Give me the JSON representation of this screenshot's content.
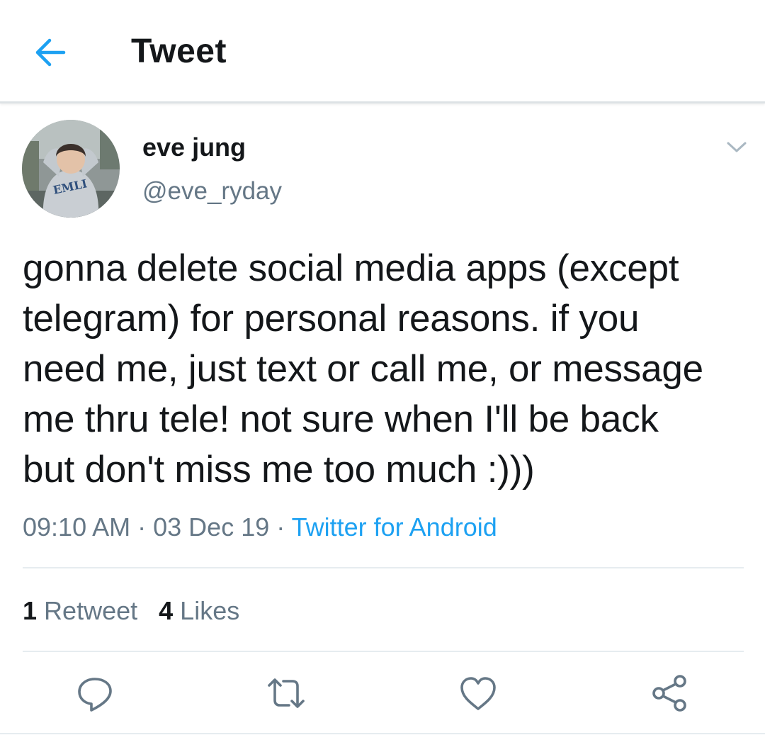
{
  "header": {
    "back_icon": "arrow-left-icon",
    "title": "Tweet"
  },
  "tweet": {
    "author": {
      "name": "eve jung",
      "handle": "@eve_ryday",
      "avatar_hoodie_text": "EMLI"
    },
    "text": "gonna delete social media apps (except\ntelegram) for personal reasons. if you\nneed me, just text or call me, or message\nme thru tele! not sure when I'll be back\nbut don't miss me too much :)))",
    "time": "09:10 AM",
    "separator": "·",
    "date": "03 Dec 19",
    "source": "Twitter for Android"
  },
  "stats": {
    "retweets": {
      "count": "1",
      "label": "Retweet"
    },
    "likes": {
      "count": "4",
      "label": "Likes"
    }
  },
  "actions": [
    {
      "icon": "reply-icon"
    },
    {
      "icon": "retweet-icon"
    },
    {
      "icon": "like-icon"
    },
    {
      "icon": "share-icon"
    }
  ],
  "colors": {
    "accent": "#1da1f2",
    "text_primary": "#14171a",
    "text_secondary": "#657786",
    "divider": "#e6ecf0"
  }
}
